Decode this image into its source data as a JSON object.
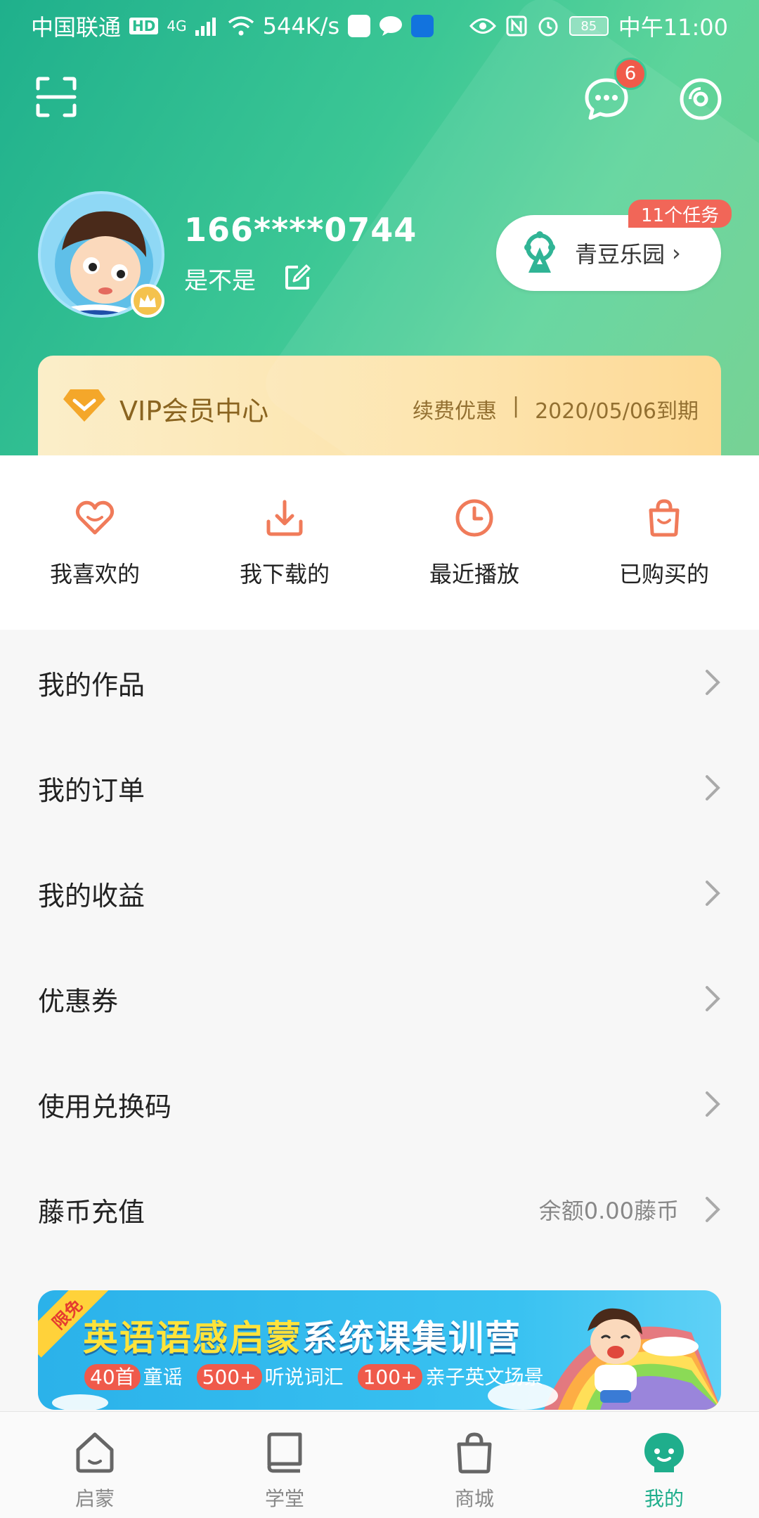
{
  "status_bar": {
    "carrier": "中国联通",
    "hd": "HD",
    "network": "4G",
    "speed": "544K/s",
    "battery": "85",
    "time": "中午11:00"
  },
  "header": {
    "message_badge": "6",
    "icons": [
      "scan-icon",
      "message-icon",
      "disc-icon"
    ]
  },
  "profile": {
    "phone": "166****0744",
    "nickname": "是不是",
    "park_button": "青豆乐园",
    "task_badge": "11个任务"
  },
  "vip": {
    "title": "VIP会员中心",
    "renew": "续费优惠",
    "separator": "|",
    "expiry": "2020/05/06到期"
  },
  "quick_actions": [
    {
      "label": "我喜欢的",
      "icon": "heart-icon"
    },
    {
      "label": "我下载的",
      "icon": "download-icon"
    },
    {
      "label": "最近播放",
      "icon": "clock-icon"
    },
    {
      "label": "已购买的",
      "icon": "bag-icon"
    }
  ],
  "menu": [
    {
      "label": "我的作品",
      "sub": ""
    },
    {
      "label": "我的订单",
      "sub": ""
    },
    {
      "label": "我的收益",
      "sub": ""
    },
    {
      "label": "优惠券",
      "sub": ""
    },
    {
      "label": "使用兑换码",
      "sub": ""
    },
    {
      "label": "藤币充值",
      "sub": "余额0.00藤币"
    }
  ],
  "banner": {
    "ribbon": "限免",
    "title_yellow": "英语语感启蒙",
    "title_white": "系统课集训营",
    "items": [
      {
        "pill": "40首",
        "text": "童谣"
      },
      {
        "pill": "500+",
        "text": "听说词汇"
      },
      {
        "pill": "100+",
        "text": "亲子英文场景"
      }
    ]
  },
  "tabs": [
    {
      "label": "启蒙",
      "icon": "home-icon",
      "active": false
    },
    {
      "label": "学堂",
      "icon": "book-icon",
      "active": false
    },
    {
      "label": "商城",
      "icon": "shop-bag-icon",
      "active": false
    },
    {
      "label": "我的",
      "icon": "profile-face-icon",
      "active": true
    }
  ],
  "colors": {
    "brand_green": "#1fae8c",
    "badge_red": "#f05a4a",
    "vip_gold": "#8a6420",
    "icon_orange": "#f07b5a"
  }
}
